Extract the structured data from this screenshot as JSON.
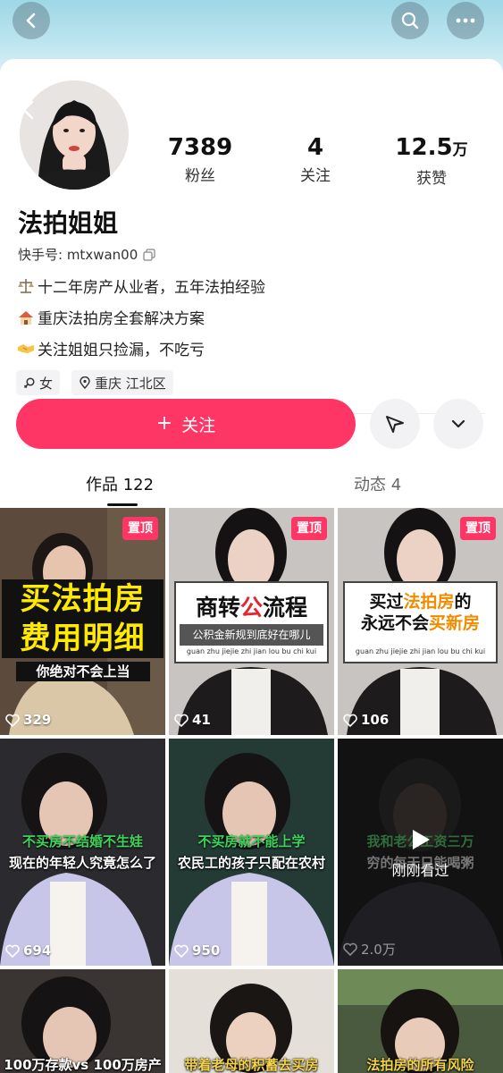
{
  "nav": {
    "back_icon": "chevron-left-icon",
    "search_icon": "search-icon",
    "more_icon": "more-dots-icon"
  },
  "profile": {
    "name": "法拍姐姐",
    "ks_id_label": "快手号: mtxwan00",
    "bio": [
      "十二年房产从业者，五年法拍经验",
      "重庆法拍房全套解决方案",
      "关注姐姐只捡漏，不吃亏"
    ],
    "gender": "女",
    "location": "重庆 江北区"
  },
  "stats": {
    "fans_value": "7389",
    "fans_label": "粉丝",
    "follow_value": "4",
    "follow_label": "关注",
    "likes_value": "12.5",
    "likes_unit": "万",
    "likes_label": "获赞"
  },
  "actions": {
    "follow_label": "关注"
  },
  "tabs": {
    "works": "作品 122",
    "moments": "动态 4"
  },
  "grid": [
    {
      "pinned": "置顶",
      "caption_line1": "买法拍房",
      "caption_line2": "费用明细",
      "caption_line3": "你绝对不会上当",
      "likes": "329"
    },
    {
      "pinned": "置顶",
      "title_a": "商转",
      "title_b": "公",
      "title_c": "流程",
      "sub": "公积金新规到底好在哪儿",
      "pinyin": "guan zhu jiejie zhi jian lou bu chi kui",
      "likes": "41"
    },
    {
      "pinned": "置顶",
      "title_a": "买过",
      "title_b": "法拍房",
      "title_c": "的",
      "title_d": "永远不会",
      "title_e": "买新房",
      "pinyin": "guan zhu jiejie zhi jian lou bu chi kui",
      "likes": "106"
    },
    {
      "caption_green": "不买房不结婚不生娃",
      "caption_white": "现在的年轻人究竟怎么了",
      "likes": "694"
    },
    {
      "caption_green": "不买房就不能上学",
      "caption_white": "农民工的孩子只配在农村",
      "likes": "950"
    },
    {
      "caption_green": "我和老公工资三万",
      "caption_white": "穷的每天只能喝粥",
      "played": "刚刚看过",
      "likes": "2.0万"
    },
    {
      "caption_white": "100万存款vs 100万房产"
    },
    {
      "caption_white": "带着老母的积蓄去买房"
    },
    {
      "caption_white": "法拍房的所有风险"
    }
  ]
}
